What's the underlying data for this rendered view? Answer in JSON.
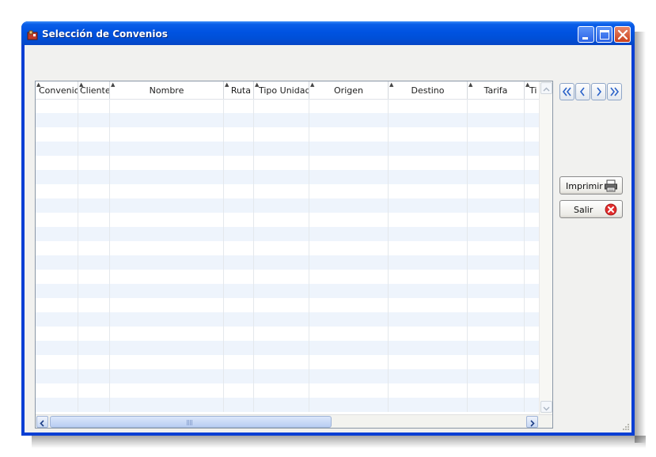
{
  "window": {
    "title": "Selección de Convenios",
    "icon": "app-icon",
    "controls": [
      "minimize-icon",
      "maximize-icon",
      "close-icon"
    ]
  },
  "table": {
    "columns": [
      "Convenio",
      "Cliente",
      "Nombre",
      "Ruta",
      "Tipo Unidad",
      "Origen",
      "Destino",
      "Tarifa",
      "Ti"
    ],
    "rows": []
  },
  "navigation": {
    "buttons": [
      "first-page-icon",
      "previous-page-icon",
      "next-page-icon",
      "last-page-icon"
    ]
  },
  "actions": {
    "print_label": "Imprimir",
    "exit_label": "Salir"
  },
  "colors": {
    "title_bar": "#0050d8",
    "row_alt": "#eef4fc",
    "exit_icon": "#e12d2d"
  }
}
